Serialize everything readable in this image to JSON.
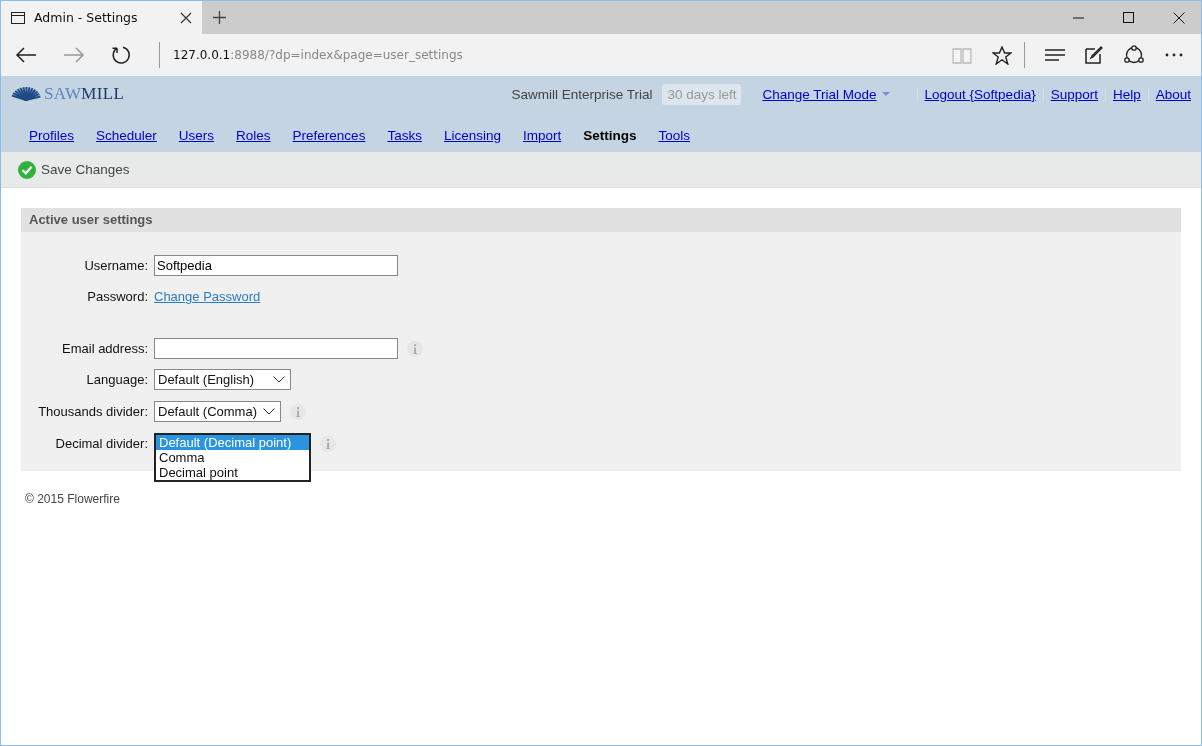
{
  "browser": {
    "tab_title": "Admin - Settings",
    "address": {
      "host": "127.0.0.1",
      "path": ":8988/?dp=index&page=user_settings"
    }
  },
  "header": {
    "logo": {
      "light": "SAW",
      "dark": "MILL"
    },
    "product": "Sawmill Enterprise Trial",
    "trial_badge": "30 days left",
    "links": [
      {
        "label": "Change Trial Mode",
        "dropdown": true
      },
      {
        "label": "Logout {Softpedia}",
        "dropdown": false
      },
      {
        "label": "Support",
        "dropdown": false
      },
      {
        "label": "Help",
        "dropdown": false
      },
      {
        "label": "About",
        "dropdown": false
      }
    ]
  },
  "nav": [
    {
      "label": "Profiles",
      "selected": false
    },
    {
      "label": "Scheduler",
      "selected": false
    },
    {
      "label": "Users",
      "selected": false
    },
    {
      "label": "Roles",
      "selected": false
    },
    {
      "label": "Preferences",
      "selected": false
    },
    {
      "label": "Tasks",
      "selected": false
    },
    {
      "label": "Licensing",
      "selected": false
    },
    {
      "label": "Import",
      "selected": false
    },
    {
      "label": "Settings",
      "selected": true
    },
    {
      "label": "Tools",
      "selected": false
    }
  ],
  "toolbar": {
    "save": "Save Changes"
  },
  "panel": {
    "title": "Active user settings",
    "fields": [
      {
        "kind": "text",
        "label": "Username:",
        "value": "Softpedia",
        "info": false
      },
      {
        "kind": "link",
        "label": "Password:",
        "value": "Change Password",
        "info": false
      },
      {
        "kind": "text",
        "label": "Email address:",
        "info": true
      },
      {
        "kind": "select",
        "label": "Language:",
        "value": "Default (English)",
        "info": false
      },
      {
        "kind": "select",
        "label": "Thousands divider:",
        "value": "Default (Comma)",
        "info": true
      },
      {
        "kind": "listbox",
        "label": "Decimal divider:",
        "info": true,
        "options": [
          {
            "label": "Default (Decimal point)",
            "selected": true
          },
          {
            "label": "Comma",
            "selected": false
          },
          {
            "label": "Decimal point",
            "selected": false
          }
        ]
      }
    ]
  },
  "footer": "© 2015 Flowerfire"
}
